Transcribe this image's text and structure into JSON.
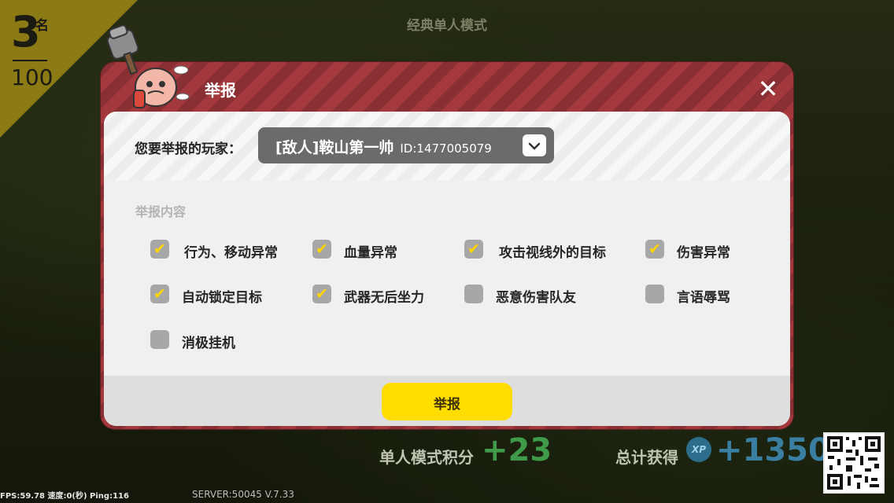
{
  "hud": {
    "rank": "3",
    "rank_unit": "名",
    "rank_total": "100",
    "mode_title": "经典单人模式",
    "score_label": "单人模式积分",
    "score_value": "+23",
    "total_label": "总计获得",
    "total_value": "+1350",
    "xp_badge": "XP",
    "fps_text": "FPS:59.78 速度:0(秒) Ping:116",
    "server_text": "SERVER:50045 V.7.33"
  },
  "dialog": {
    "title": "举报",
    "close_icon": "close-icon",
    "player_label": "您要举报的玩家：",
    "player_name": "[敌人]鞍山第一帅",
    "player_id": "ID:1477005079",
    "section_title": "举报内容",
    "options": [
      {
        "label": "行为、移动异常",
        "checked": true
      },
      {
        "label": "血量异常",
        "checked": true
      },
      {
        "label": "攻击视线外的目标",
        "checked": true
      },
      {
        "label": "伤害异常",
        "checked": true
      },
      {
        "label": "自动锁定目标",
        "checked": true
      },
      {
        "label": "武器无后坐力",
        "checked": true
      },
      {
        "label": "恶意伤害队友",
        "checked": false
      },
      {
        "label": "言语辱骂",
        "checked": false
      },
      {
        "label": "消极挂机",
        "checked": false
      }
    ],
    "submit_label": "举报"
  },
  "colors": {
    "accent_yellow": "#ffdd00",
    "dialog_red": "#a3393d",
    "score_green": "#3f9a4a",
    "xp_blue": "#3a7ea2"
  }
}
